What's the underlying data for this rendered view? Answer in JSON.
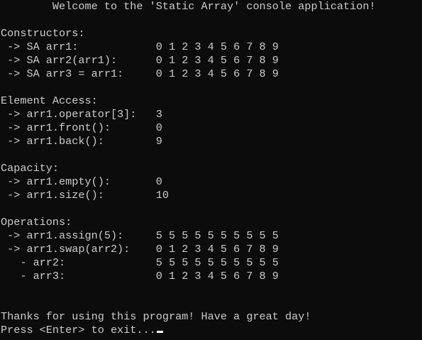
{
  "console": {
    "welcome": "        Welcome to the 'Static Array' console application!",
    "constructors_header": "Constructors:",
    "constructors": [
      " -> SA arr1:            0 1 2 3 4 5 6 7 8 9",
      " -> SA arr2(arr1):      0 1 2 3 4 5 6 7 8 9",
      " -> SA arr3 = arr1:     0 1 2 3 4 5 6 7 8 9"
    ],
    "element_access_header": "Element Access:",
    "element_access": [
      " -> arr1.operator[3]:   3",
      " -> arr1.front():       0",
      " -> arr1.back():        9"
    ],
    "capacity_header": "Capacity:",
    "capacity": [
      " -> arr1.empty():       0",
      " -> arr1.size():        10"
    ],
    "operations_header": "Operations:",
    "operations": [
      " -> arr1.assign(5):     5 5 5 5 5 5 5 5 5 5",
      " -> arr1.swap(arr2):    0 1 2 3 4 5 6 7 8 9",
      "   - arr2:              5 5 5 5 5 5 5 5 5 5",
      "   - arr3:              0 1 2 3 4 5 6 7 8 9"
    ],
    "thanks": "Thanks for using this program! Have a great day!",
    "prompt": "Press <Enter> to exit..."
  }
}
